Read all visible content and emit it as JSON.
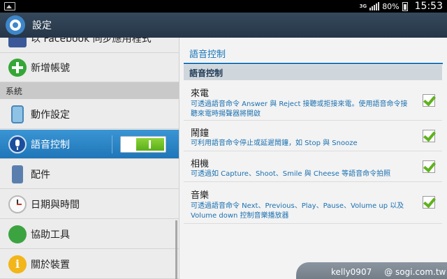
{
  "status_bar": {
    "network": "3G",
    "battery_percent": "80%",
    "time": "15:53"
  },
  "action_bar": {
    "title": "設定",
    "icon": "gear-icon"
  },
  "left_pane": {
    "items_top": [
      {
        "label": "以 Facebook 同步應用程式",
        "icon": "facebook-icon"
      },
      {
        "label": "新增帳號",
        "icon": "add-icon"
      }
    ],
    "section_header": "系統",
    "items_system": [
      {
        "label": "動作設定",
        "icon": "motion-icon"
      },
      {
        "label": "語音控制",
        "icon": "voice-control-icon",
        "selected": true,
        "toggle_on": true
      },
      {
        "label": "配件",
        "icon": "accessory-icon"
      },
      {
        "label": "日期與時間",
        "icon": "clock-icon"
      },
      {
        "label": "協助工具",
        "icon": "hand-icon"
      },
      {
        "label": "關於裝置",
        "icon": "info-icon"
      }
    ]
  },
  "right_pane": {
    "title": "語音控制",
    "section": "語音控制",
    "items": [
      {
        "title": "來電",
        "summary": "可透過語音命令 Answer 與 Reject 接聽或拒接來電。使用語音命令接聽來電時揚聲器將開啟",
        "checked": true
      },
      {
        "title": "鬧鐘",
        "summary": "可利用語音命令停止或延遲鬧鐘，如 Stop 與 Snooze",
        "checked": true
      },
      {
        "title": "相機",
        "summary": "可透過如 Capture、Shoot、Smile 與 Cheese 等語音命令拍照",
        "checked": true
      },
      {
        "title": "音樂",
        "summary": "可透過語音命令 Next、Previous、Play、Pause、Volume up 以及 Volume down 控制音樂播放器",
        "checked": true
      }
    ]
  },
  "watermark": {
    "user": "kelly0907",
    "site": "@ sogi.com.tw"
  },
  "colors": {
    "accent_blue": "#1a76b8",
    "selected_bg": "#2d88c9",
    "toggle_green": "#6abf1f",
    "check_green": "#5fb21d"
  }
}
